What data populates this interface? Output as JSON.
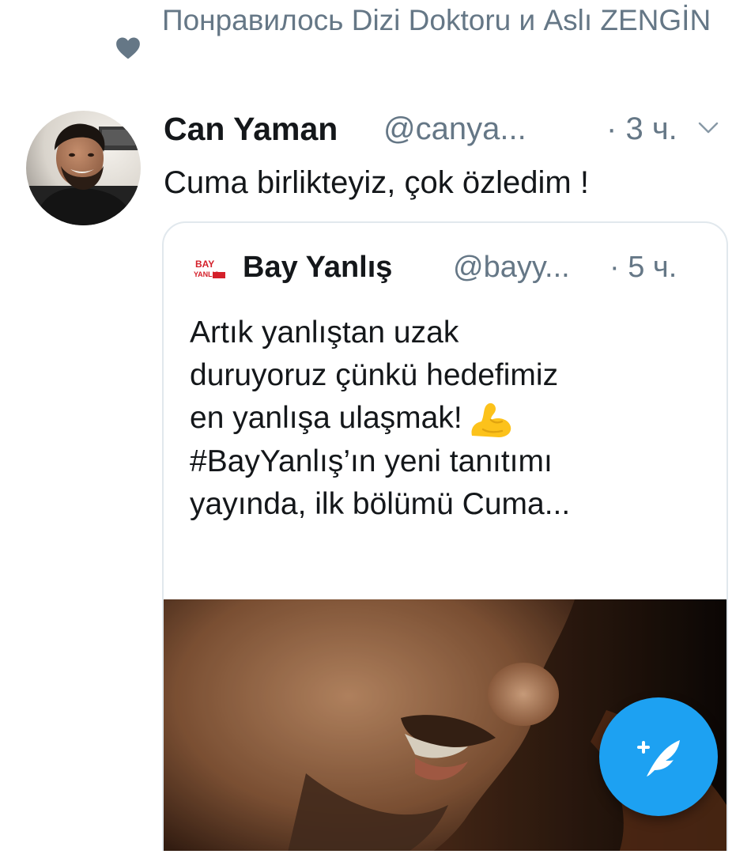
{
  "context": {
    "icon": "heart-icon",
    "text": "Понравилось Dizi Doktoru и Aslı ZENGİN"
  },
  "tweet": {
    "author_name": "Can Yaman",
    "author_handle": "@canya...",
    "separator": "·",
    "time": "3 ч.",
    "text": "Cuma birlikteyiz, çok özledim !",
    "menu_icon": "chevron-down-icon"
  },
  "quoted_tweet": {
    "logo_text": "BAY YANLIŞ",
    "author_name": "Bay Yanlış",
    "author_handle": "@bayy...",
    "separator": "·",
    "time": "5 ч.",
    "lines": [
      "Artık yanlıştan uzak",
      "duruyoruz çünkü hedefimiz",
      "en yanlışa ulaşmak!",
      "#BayYanlış’ın yeni tanıtımı",
      "yayında, ilk bölümü Cuma..."
    ],
    "emoji": "flexed-biceps-emoji"
  },
  "fab": {
    "icon": "compose-tweet-icon"
  },
  "colors": {
    "accent": "#1da1f2",
    "text": "#14171a",
    "secondary": "#657786",
    "border": "#e1e8ed"
  }
}
